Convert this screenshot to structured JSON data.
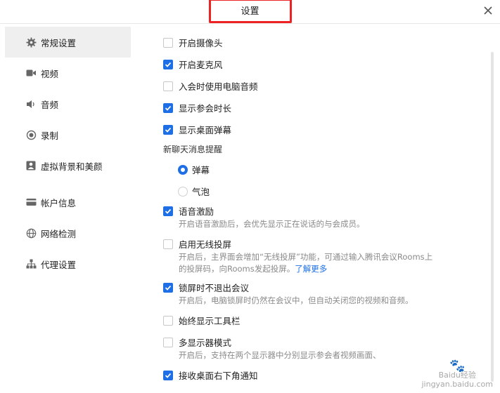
{
  "window": {
    "title": "设置",
    "close_label": "×"
  },
  "sidebar": {
    "items": [
      {
        "label": "常规设置",
        "icon": "gear-icon",
        "active": true
      },
      {
        "label": "视频",
        "icon": "video-camera-icon"
      },
      {
        "label": "音频",
        "icon": "speaker-icon"
      },
      {
        "label": "录制",
        "icon": "record-icon"
      },
      {
        "label": "虚拟背景和美颜",
        "icon": "portrait-icon"
      },
      {
        "label": "帐户信息",
        "icon": "id-card-icon"
      },
      {
        "label": "网络检测",
        "icon": "globe-icon"
      },
      {
        "label": "代理设置",
        "icon": "network-tree-icon"
      }
    ]
  },
  "settings": {
    "camera": {
      "label": "开启摄像头",
      "checked": false
    },
    "mic": {
      "label": "开启麦克风",
      "checked": true
    },
    "pc_audio": {
      "label": "入会时使用电脑音频",
      "checked": false
    },
    "duration": {
      "label": "显示参会时长",
      "checked": true
    },
    "danmaku": {
      "label": "显示桌面弹幕",
      "checked": true
    },
    "chat_alert": {
      "label": "新聊天消息提醒",
      "options": [
        "弹幕",
        "气泡"
      ],
      "selected": "弹幕"
    },
    "voice_incentive": {
      "label": "语音激励",
      "checked": true,
      "desc": "开启语音激励后，会优先显示正在说话的与会成员。"
    },
    "wireless": {
      "label": "启用无线投屏",
      "checked": false,
      "desc_line1": "开启后，主界面会增加“无线投屏”功能，可通过输入腾讯会议Rooms上",
      "desc_line2": "的投屏码，向Rooms发起投屏。",
      "link": "了解更多"
    },
    "lock_screen": {
      "label": "锁屏时不退出会议",
      "checked": true,
      "desc": "开启后，电脑锁屏时仍然在会议中，但自动关闭您的视频和音频。"
    },
    "toolbar": {
      "label": "始终显示工具栏",
      "checked": false
    },
    "multi_display": {
      "label": "多显示器模式",
      "checked": false,
      "desc": "开启后，支持在两个显示器中分别显示参会者视频画面、"
    },
    "notify": {
      "label": "接收桌面右下角通知",
      "checked": true
    }
  },
  "watermark": {
    "line1": "Baidu经验",
    "line2": "jingyan.baidu.com"
  },
  "colors": {
    "accent": "#1e6fe6",
    "highlight_box": "#ee2222"
  }
}
